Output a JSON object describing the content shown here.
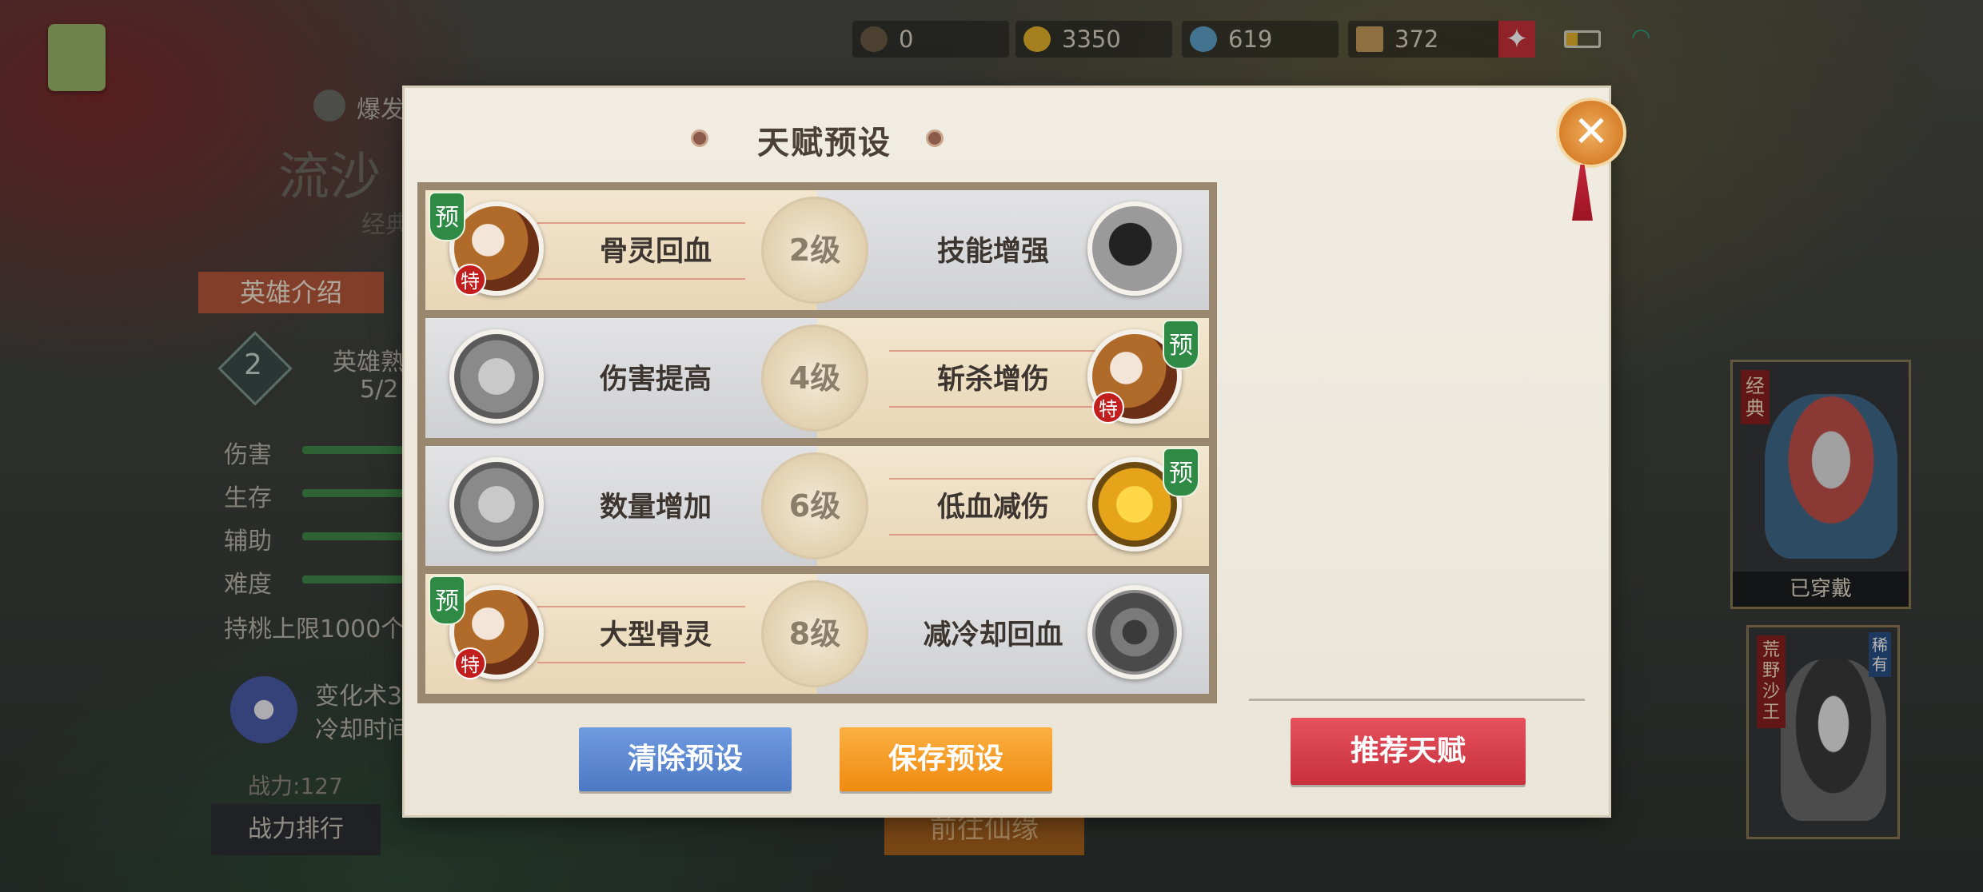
{
  "status_bar": {
    "res1": "0",
    "res2": "3350",
    "res3": "619",
    "res4": "372"
  },
  "background": {
    "hero_type_label": "爆发/",
    "hero_name": "流沙",
    "hero_sub": "经典",
    "hero_intro_tab": "英雄介绍",
    "level_badge": "2",
    "proficiency_label": "英雄熟",
    "proficiency_value": "5/2",
    "stats": [
      {
        "label": "伤害",
        "fill": 0.7
      },
      {
        "label": "生存",
        "fill": 0.7
      },
      {
        "label": "辅助",
        "fill": 0.7
      },
      {
        "label": "难度",
        "fill": 0.7
      }
    ],
    "peach_limit": "持桃上限1000个",
    "skill_name": "变化术3",
    "skill_cd": "冷却时间",
    "power": "战力:127",
    "rank_button": "战力排行",
    "goto_button": "前往仙缘",
    "card1_tag": "经典",
    "card1_status": "已穿戴",
    "card2_tag": "荒野沙王",
    "card2_rare": "稀有"
  },
  "modal": {
    "title": "天赋预设",
    "close_icon": "close-icon",
    "rows": [
      {
        "left": "骨灵回血",
        "level": "2级",
        "right": "技能增强"
      },
      {
        "left": "伤害提高",
        "level": "4级",
        "right": "斩杀增伤"
      },
      {
        "left": "数量增加",
        "level": "6级",
        "right": "低血减伤"
      },
      {
        "left": "大型骨灵",
        "level": "8级",
        "right": "减冷却回血"
      }
    ],
    "badge_preset": "预",
    "badge_special": "特",
    "clear_button": "清除预设",
    "save_button": "保存预设",
    "recommend_button": "推荐天赋"
  }
}
